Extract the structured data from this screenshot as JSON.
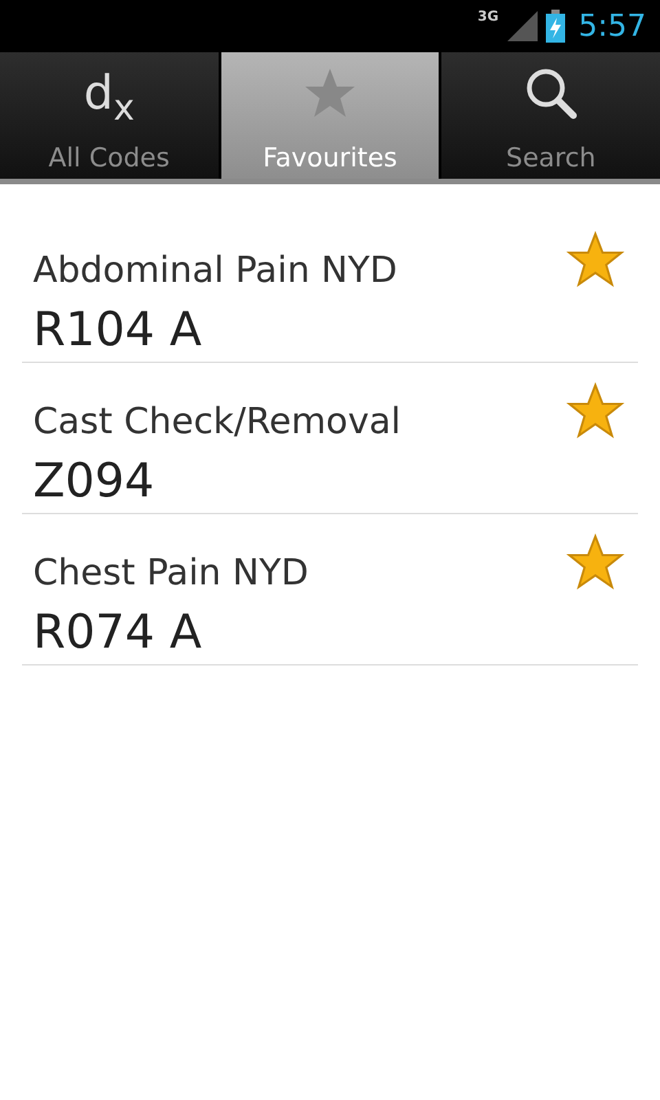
{
  "status_bar": {
    "network": "3G",
    "time": "5:57"
  },
  "tabs": [
    {
      "kind": "dx",
      "icon_text": "d$_{x}$",
      "label": "All Codes",
      "selected": false
    },
    {
      "kind": "star",
      "label": "Favourites",
      "selected": true
    },
    {
      "kind": "search",
      "label": "Search",
      "selected": false
    }
  ],
  "favourites": [
    {
      "name": "Abdominal Pain NYD",
      "code": "R104 A",
      "favourite": true
    },
    {
      "name": "Cast Check/Removal",
      "code": "Z094",
      "favourite": true
    },
    {
      "name": "Chest Pain NYD",
      "code": "R074 A",
      "favourite": true
    }
  ]
}
